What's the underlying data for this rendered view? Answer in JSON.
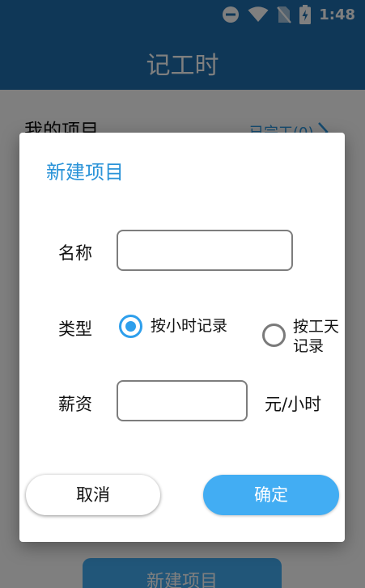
{
  "status_bar": {
    "time": "1:48",
    "icons": [
      "do-not-disturb-icon",
      "wifi-icon",
      "no-sim-icon",
      "battery-charging-icon"
    ]
  },
  "app_bar": {
    "title": "记工时"
  },
  "projects": {
    "header": "我的项目",
    "completed_link": "已完工(0)"
  },
  "bottom_button": {
    "label": "新建项目"
  },
  "dialog": {
    "title": "新建项目",
    "name_label": "名称",
    "name_value": "",
    "type_label": "类型",
    "type_options": [
      {
        "label": "按小时记录",
        "selected": true
      },
      {
        "label": "按工天\n记录",
        "selected": false
      }
    ],
    "salary_label": "薪资",
    "salary_value": "",
    "salary_unit": "元/小时",
    "cancel_label": "取消",
    "confirm_label": "确定"
  },
  "colors": {
    "app_bar": "#1f6fae",
    "accent": "#2e9fec",
    "confirm_button": "#42adf3",
    "dialog_title": "#2a93d8"
  }
}
